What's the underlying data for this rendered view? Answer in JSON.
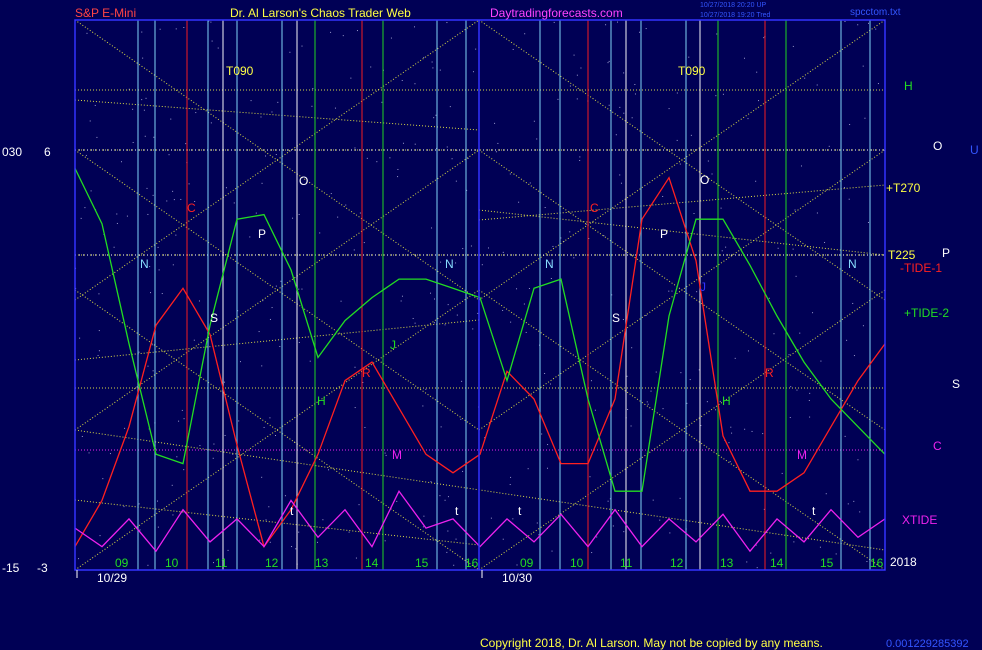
{
  "header": {
    "symbol": "S&P E-Mini",
    "title": "Dr. Al Larson's Chaos Trader Web",
    "site": "Daytradingforecasts.com",
    "stamp1": "10/27/2018 20:20 UP",
    "stamp2": "10/27/2018 19:20 Tred",
    "file": "spcctom.txt"
  },
  "left_axis": {
    "top_a": "030",
    "top_b": "6",
    "bot_a": "-15",
    "bot_b": "-3"
  },
  "footer": {
    "copyright": "Copyright 2018, Dr. Al Larson. May not be copied by any means.",
    "code": "0.001229285392"
  },
  "right_labels": [
    "H",
    "O",
    "U",
    "+T270",
    "T225",
    "P",
    "-TIDE-1",
    "+TIDE-2",
    "S",
    "C",
    "XTIDE",
    "2018"
  ],
  "colors": {
    "background": "#000055",
    "plot_border": "#3333ff",
    "red": "#ff2020",
    "green": "#22dd22",
    "magenta": "#ee22ee",
    "yellow": "#ffff44",
    "cyan": "#88ddff",
    "white": "#ffffff"
  },
  "chart_data": {
    "type": "line",
    "x_axis": {
      "days": [
        {
          "date": "10/29",
          "hours": [
            "09",
            "10",
            "11",
            "12",
            "13",
            "14",
            "15",
            "16"
          ]
        },
        {
          "date": "10/30",
          "hours": [
            "09",
            "10",
            "11",
            "12",
            "13",
            "14",
            "15",
            "16"
          ]
        }
      ]
    },
    "series": [
      {
        "name": "-TIDE-1",
        "color": "#ff2020",
        "values": [
          -2.6,
          -1.6,
          0.0,
          2.2,
          3.0,
          2.0,
          -0.4,
          -2.6,
          -1.8,
          -0.6,
          1.0,
          1.4,
          0.4,
          -0.6,
          -1.0,
          -0.6,
          1.2,
          0.6,
          -0.8,
          -0.8,
          0.6,
          4.5,
          5.4,
          3.6,
          -0.2,
          -1.4,
          -1.4,
          -1.0,
          0.0,
          1.0,
          1.8
        ]
      },
      {
        "name": "+TIDE-2",
        "color": "#22dd22",
        "values": [
          5.6,
          4.4,
          1.8,
          -0.6,
          -0.8,
          2.2,
          4.5,
          4.6,
          3.4,
          1.5,
          2.3,
          2.8,
          3.2,
          3.2,
          3.0,
          2.8,
          1.0,
          3.0,
          3.2,
          0.6,
          -1.4,
          -1.4,
          2.4,
          4.5,
          4.5,
          3.5,
          2.4,
          1.4,
          0.6,
          0.0,
          -0.6
        ]
      },
      {
        "name": "XTIDE",
        "color": "#ee22ee",
        "values": [
          -2.2,
          -2.6,
          -2.0,
          -2.7,
          -1.8,
          -2.5,
          -2.0,
          -2.6,
          -1.6,
          -2.4,
          -1.8,
          -2.6,
          -1.4,
          -2.2,
          -2.0,
          -2.6,
          -2.0,
          -2.5,
          -1.9,
          -2.6,
          -1.8,
          -2.6,
          -2.0,
          -2.5,
          -1.9,
          -2.7,
          -2.0,
          -2.5,
          -1.8,
          -2.4,
          -2.0
        ]
      }
    ],
    "marker_letters": [
      {
        "text": "T090",
        "color": "#ffff44"
      },
      {
        "text": "T090",
        "color": "#ffff44"
      },
      {
        "text": "C",
        "color": "#ff2020"
      },
      {
        "text": "C",
        "color": "#ff2020"
      },
      {
        "text": "O",
        "color": "#ffffff"
      },
      {
        "text": "O",
        "color": "#ffffff"
      },
      {
        "text": "P",
        "color": "#ffffff"
      },
      {
        "text": "P",
        "color": "#ffffff"
      },
      {
        "text": "N",
        "color": "#88ddff"
      },
      {
        "text": "N",
        "color": "#88ddff"
      },
      {
        "text": "N",
        "color": "#88ddff"
      },
      {
        "text": "N",
        "color": "#88ddff"
      },
      {
        "text": "S",
        "color": "#ffffff"
      },
      {
        "text": "S",
        "color": "#ffffff"
      },
      {
        "text": "R",
        "color": "#ff2020"
      },
      {
        "text": "R",
        "color": "#ff2020"
      },
      {
        "text": "H",
        "color": "#22dd22"
      },
      {
        "text": "H",
        "color": "#22dd22"
      },
      {
        "text": "M",
        "color": "#ee22ee"
      },
      {
        "text": "M",
        "color": "#ee22ee"
      },
      {
        "text": "J",
        "color": "#22dd22"
      },
      {
        "text": "J",
        "color": "#3333ff"
      },
      {
        "text": "t",
        "color": "#ffffff"
      },
      {
        "text": "t",
        "color": "#ffffff"
      },
      {
        "text": "t",
        "color": "#ffffff"
      },
      {
        "text": "t",
        "color": "#ffffff"
      }
    ]
  }
}
